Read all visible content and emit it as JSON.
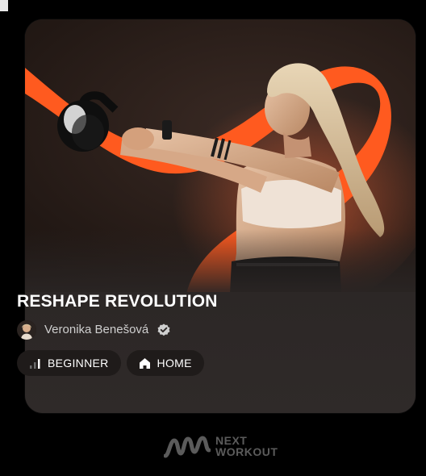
{
  "program": {
    "title": "RESHAPE REVOLUTION",
    "author": "Veronika Benešová",
    "tags": [
      {
        "label": "BEGINNER",
        "icon": "bars-icon"
      },
      {
        "label": "HOME",
        "icon": "home-icon"
      }
    ]
  },
  "brand": {
    "line1": "NEXT",
    "line2": "WORKOUT"
  },
  "colors": {
    "accent": "#ff5a1f",
    "background": "#000000",
    "card": "#2c2726",
    "chip": "#1f1b1a"
  }
}
